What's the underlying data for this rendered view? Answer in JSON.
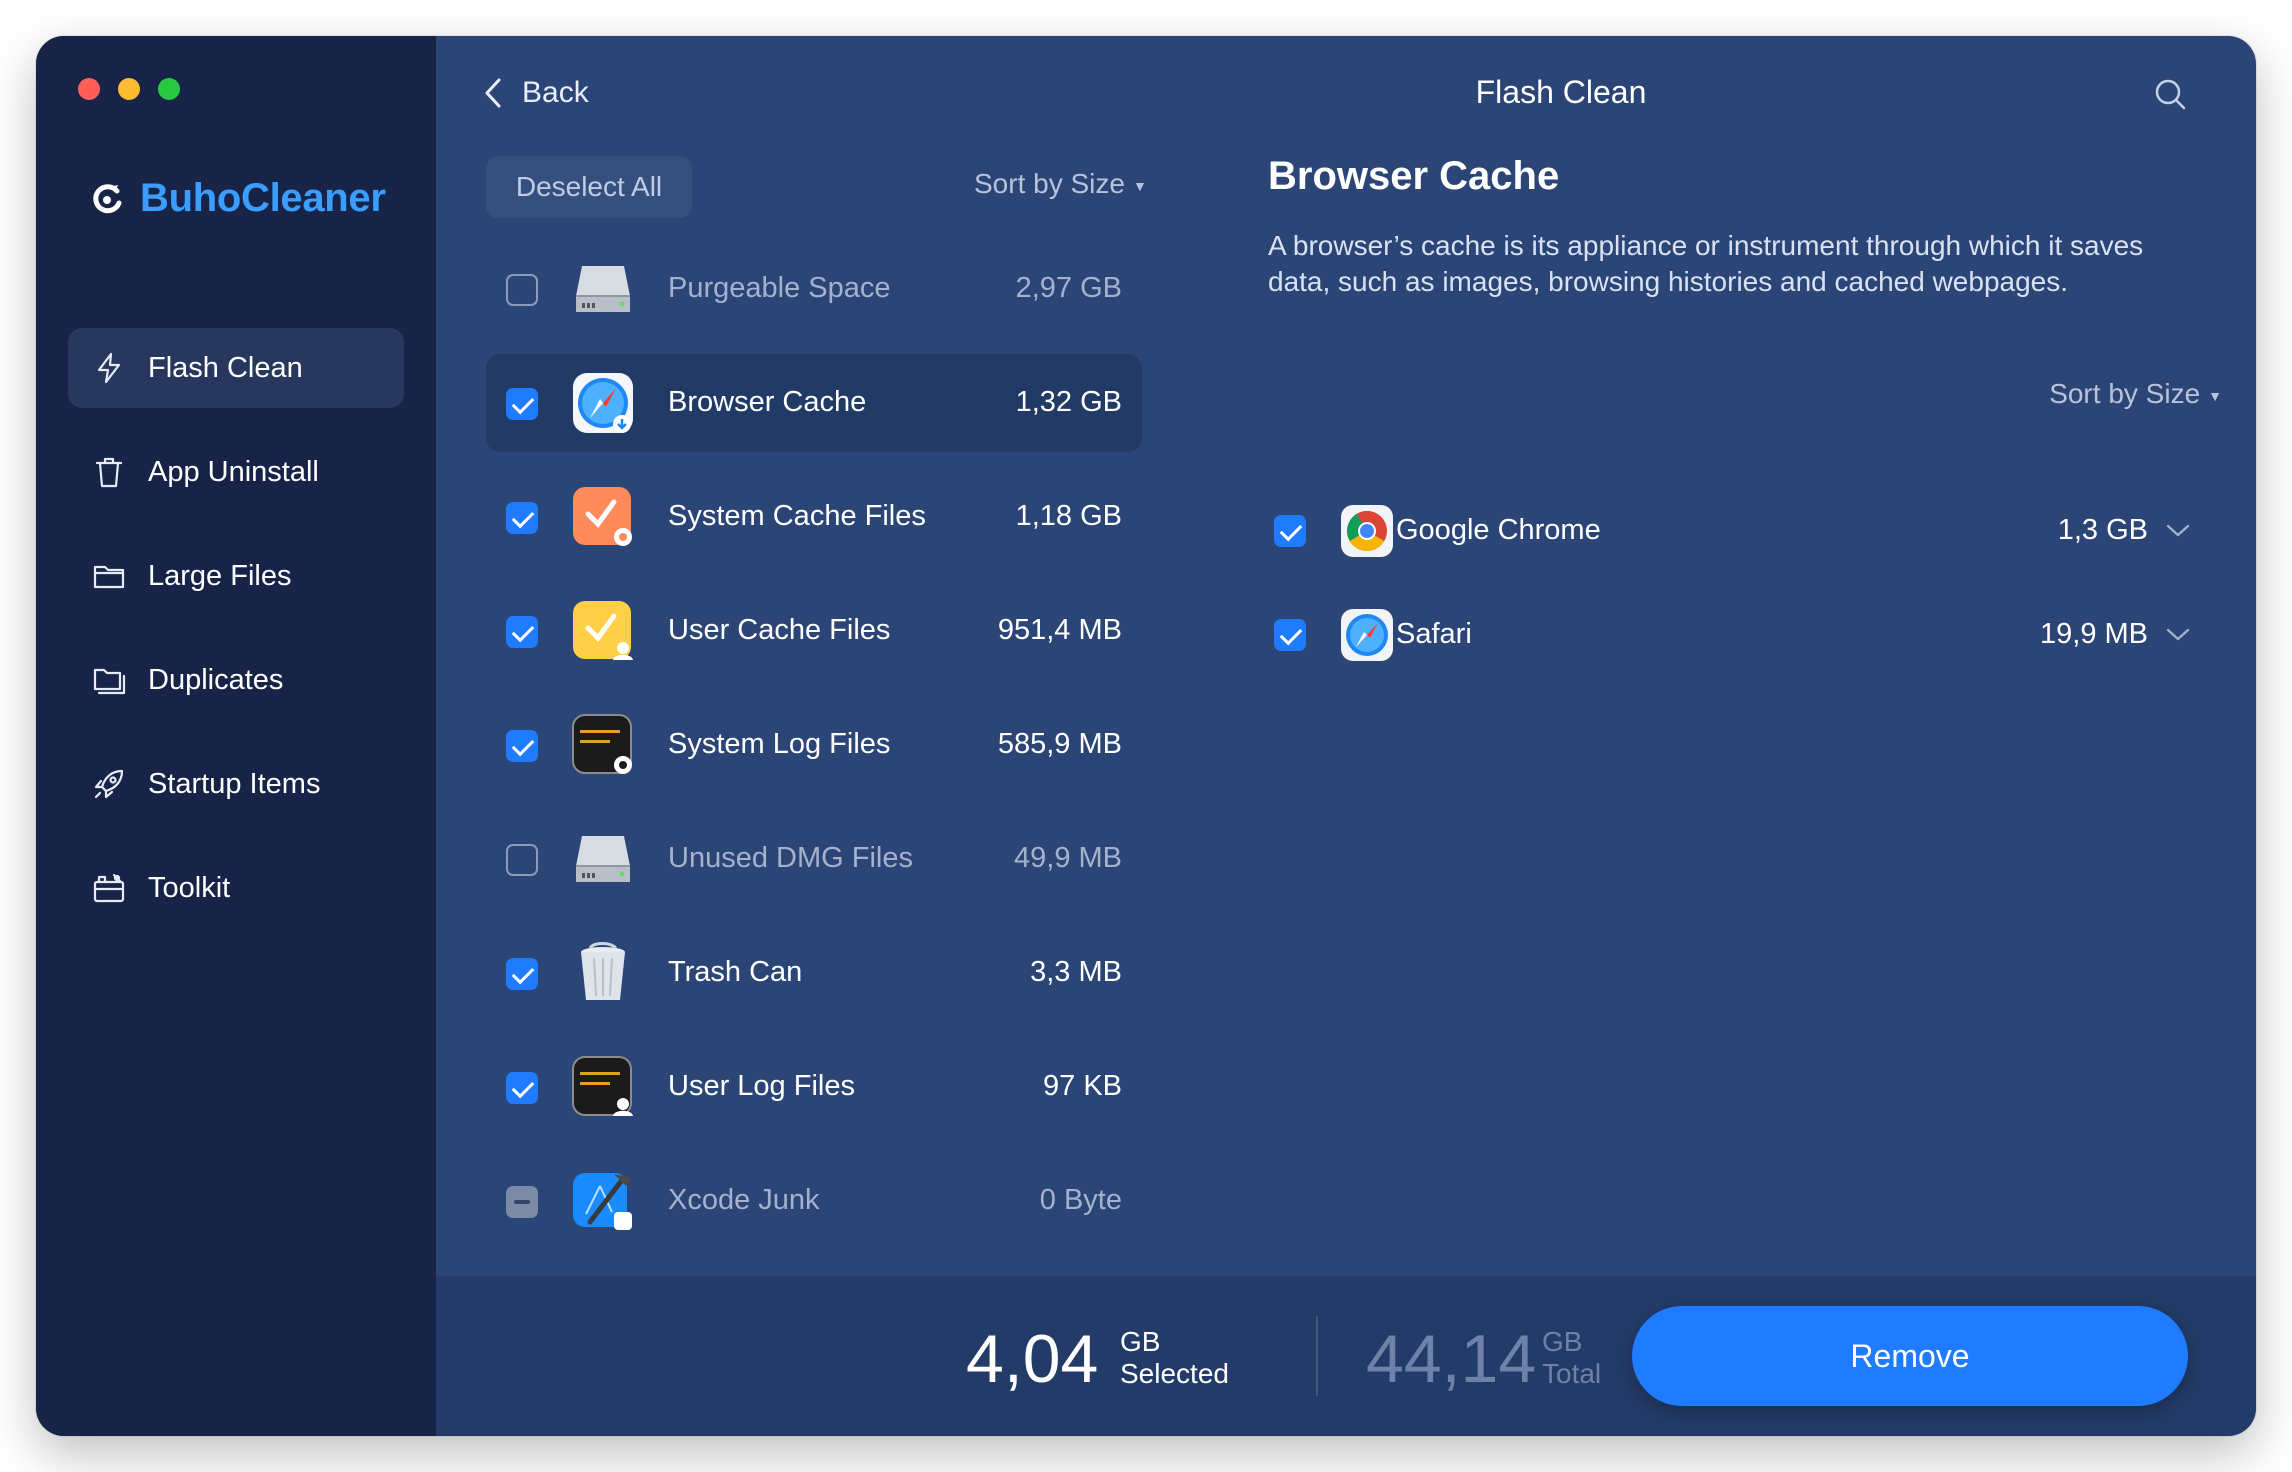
{
  "app": {
    "name": "BuhoCleaner",
    "brand_color": "#3b9dff"
  },
  "sidebar": {
    "items": [
      {
        "label": "Flash Clean",
        "icon": "bolt-icon",
        "active": true
      },
      {
        "label": "App Uninstall",
        "icon": "trash-icon",
        "active": false
      },
      {
        "label": "Large Files",
        "icon": "folder-icon",
        "active": false
      },
      {
        "label": "Duplicates",
        "icon": "duplicate-folder-icon",
        "active": false
      },
      {
        "label": "Startup Items",
        "icon": "rocket-icon",
        "active": false
      },
      {
        "label": "Toolkit",
        "icon": "toolbox-icon",
        "active": false
      }
    ]
  },
  "header": {
    "back_label": "Back",
    "title": "Flash Clean"
  },
  "list": {
    "deselect_label": "Deselect All",
    "sort_label": "Sort by Size",
    "items": [
      {
        "label": "Purgeable Space",
        "size": "2,97 GB",
        "checked": "off",
        "icon": "drive-icon",
        "dim": true,
        "selected": false
      },
      {
        "label": "Browser Cache",
        "size": "1,32 GB",
        "checked": "on",
        "icon": "safari-download-icon",
        "dim": false,
        "selected": true
      },
      {
        "label": "System Cache Files",
        "size": "1,18 GB",
        "checked": "on",
        "icon": "system-cache-icon",
        "dim": false,
        "selected": false
      },
      {
        "label": "User Cache Files",
        "size": "951,4 MB",
        "checked": "on",
        "icon": "user-cache-icon",
        "dim": false,
        "selected": false
      },
      {
        "label": "System Log Files",
        "size": "585,9 MB",
        "checked": "on",
        "icon": "system-log-icon",
        "dim": false,
        "selected": false
      },
      {
        "label": "Unused DMG Files",
        "size": "49,9 MB",
        "checked": "off",
        "icon": "drive-icon",
        "dim": true,
        "selected": false
      },
      {
        "label": "Trash Can",
        "size": "3,3 MB",
        "checked": "on",
        "icon": "trash-can-icon",
        "dim": false,
        "selected": false
      },
      {
        "label": "User Log Files",
        "size": "97 KB",
        "checked": "on",
        "icon": "user-log-icon",
        "dim": false,
        "selected": false
      },
      {
        "label": "Xcode Junk",
        "size": "0 Byte",
        "checked": "mixed",
        "icon": "xcode-icon",
        "dim": true,
        "selected": false
      }
    ]
  },
  "detail": {
    "title": "Browser Cache",
    "description": "A browser’s cache is its appliance or instrument through which it saves data, such as images, browsing histories and cached webpages.",
    "sort_label": "Sort by Size",
    "browsers": [
      {
        "name": "Google Chrome",
        "size": "1,3 GB",
        "checked": true,
        "icon": "chrome-icon"
      },
      {
        "name": "Safari",
        "size": "19,9 MB",
        "checked": true,
        "icon": "safari-icon"
      }
    ]
  },
  "footer": {
    "selected_value": "4,04",
    "selected_unit": "GB",
    "selected_label": "Selected",
    "total_value": "44,14",
    "total_unit": "GB",
    "total_label": "Total",
    "remove_label": "Remove",
    "accent_color": "#1f7bff"
  }
}
